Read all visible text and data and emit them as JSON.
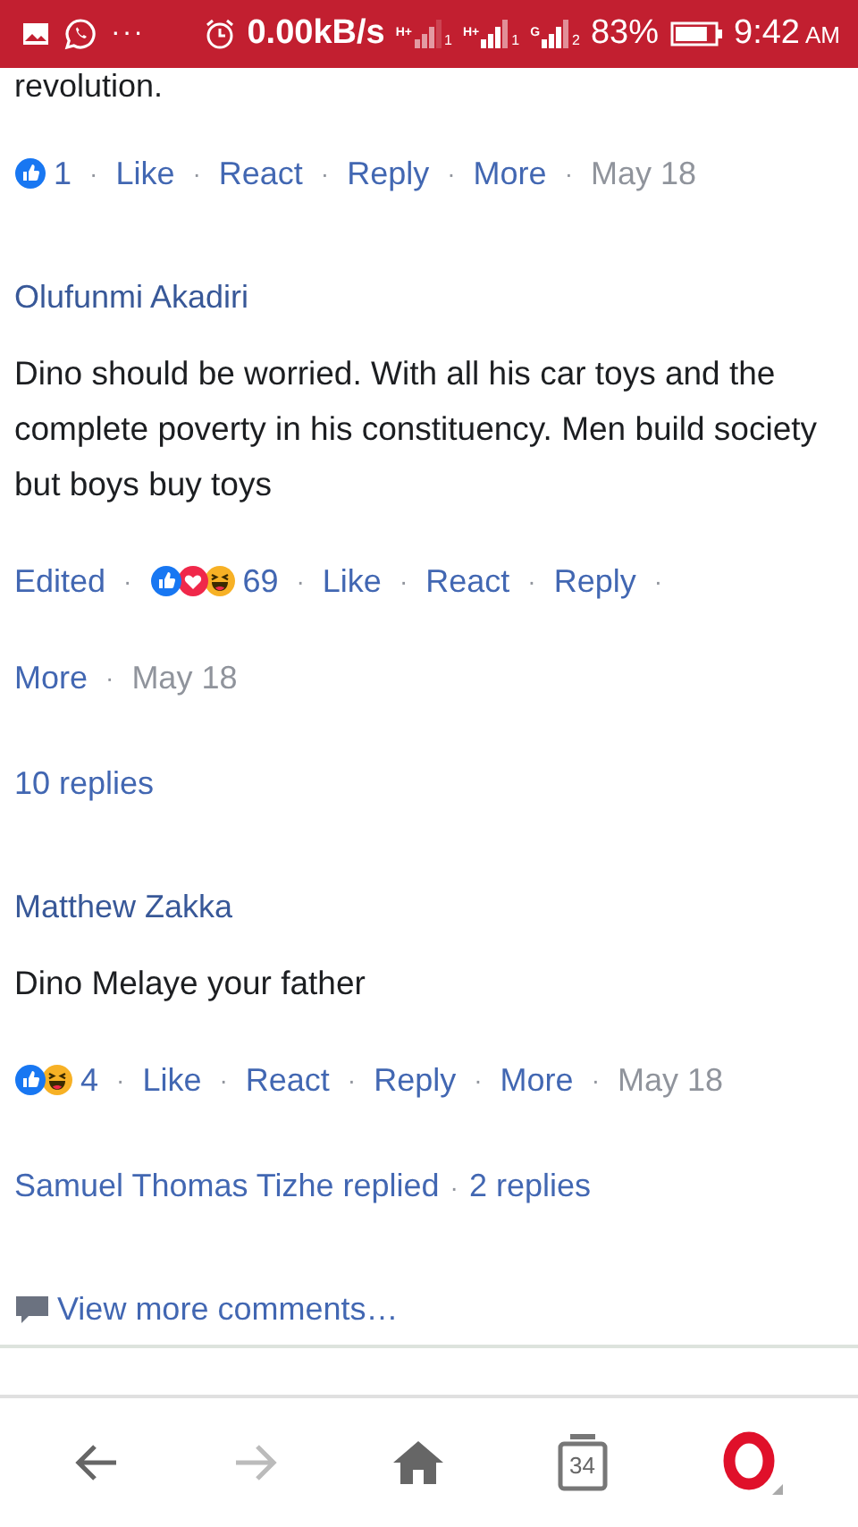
{
  "status_bar": {
    "more": "···",
    "speed": "0.00kB/s",
    "networks": [
      {
        "type": "H+",
        "sim": "1",
        "strong": false
      },
      {
        "type": "H+",
        "sim": "1",
        "strong": true
      },
      {
        "type": "G",
        "sim": "2",
        "strong": true
      }
    ],
    "battery": "83%",
    "time": "9:42",
    "ampm": "AM"
  },
  "top": {
    "text": "revolution.",
    "actions": [
      [
        {
          "kind": "reactions",
          "reactions": [
            {
              "kind": "like"
            }
          ]
        },
        {
          "kind": "count",
          "text": "1"
        },
        {
          "kind": "dot",
          "text": "·"
        },
        {
          "kind": "link",
          "text": "Like"
        },
        {
          "kind": "dot",
          "text": "·"
        },
        {
          "kind": "link",
          "text": "React"
        },
        {
          "kind": "dot",
          "text": "·"
        },
        {
          "kind": "link",
          "text": "Reply"
        },
        {
          "kind": "dot",
          "text": "·"
        },
        {
          "kind": "link",
          "text": "More"
        },
        {
          "kind": "dot",
          "text": "·"
        },
        {
          "kind": "date",
          "text": "May 18"
        }
      ]
    ]
  },
  "comments": [
    {
      "author": "Olufunmi Akadiri",
      "text": "Dino should be worried. With all his car toys and the complete poverty in his constituency. Men build society but boys buy toys",
      "actions": [
        [
          {
            "kind": "link",
            "text": "Edited"
          },
          {
            "kind": "dot",
            "text": "·"
          },
          {
            "kind": "reactions",
            "reactions": [
              {
                "kind": "like"
              },
              {
                "kind": "love"
              },
              {
                "kind": "haha"
              }
            ]
          },
          {
            "kind": "count",
            "text": "69"
          },
          {
            "kind": "dot",
            "text": "·"
          },
          {
            "kind": "link",
            "text": "Like"
          },
          {
            "kind": "dot",
            "text": "·"
          },
          {
            "kind": "link",
            "text": "React"
          },
          {
            "kind": "dot",
            "text": "·"
          },
          {
            "kind": "link",
            "text": "Reply"
          },
          {
            "kind": "dot",
            "text": "·"
          }
        ],
        [
          {
            "kind": "link",
            "text": "More"
          },
          {
            "kind": "dot",
            "text": "·"
          },
          {
            "kind": "date",
            "text": "May 18"
          }
        ]
      ],
      "replies": [
        {
          "kind": "link",
          "text": "10 replies"
        }
      ]
    },
    {
      "author": "Matthew Zakka",
      "text": "Dino Melaye your father",
      "actions": [
        [
          {
            "kind": "reactions",
            "reactions": [
              {
                "kind": "like"
              },
              {
                "kind": "haha"
              }
            ]
          },
          {
            "kind": "count",
            "text": "4"
          },
          {
            "kind": "dot",
            "text": "·"
          },
          {
            "kind": "link",
            "text": "Like"
          },
          {
            "kind": "dot",
            "text": "·"
          },
          {
            "kind": "link",
            "text": "React"
          },
          {
            "kind": "dot",
            "text": "·"
          },
          {
            "kind": "link",
            "text": "Reply"
          },
          {
            "kind": "dot",
            "text": "·"
          },
          {
            "kind": "link",
            "text": "More"
          },
          {
            "kind": "dot",
            "text": "·"
          },
          {
            "kind": "date",
            "text": "May 18"
          }
        ]
      ],
      "replies": [
        {
          "kind": "link",
          "text": "Samuel Thomas Tizhe replied"
        },
        {
          "kind": "dot",
          "text": "·"
        },
        {
          "kind": "link",
          "text": "2 replies"
        }
      ]
    }
  ],
  "view_more": "View more comments…",
  "nav": {
    "back_enabled": true,
    "forward_enabled": false,
    "tabs": "34"
  }
}
